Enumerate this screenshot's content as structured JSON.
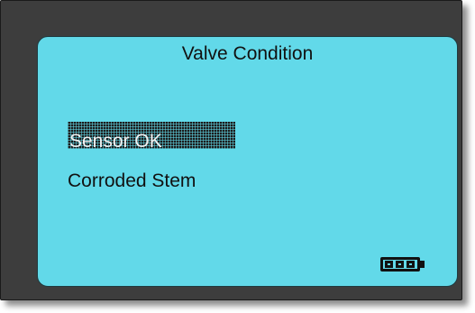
{
  "screen": {
    "title": "Valve Condition",
    "menu": [
      {
        "label": "Sensor OK",
        "selected": true
      },
      {
        "label": "Corroded Stem",
        "selected": false
      }
    ],
    "battery_icon": "battery-full-icon"
  },
  "colors": {
    "screen_background": "#62d9e9",
    "bezel": "#3d3d3d",
    "text": "#111111"
  }
}
